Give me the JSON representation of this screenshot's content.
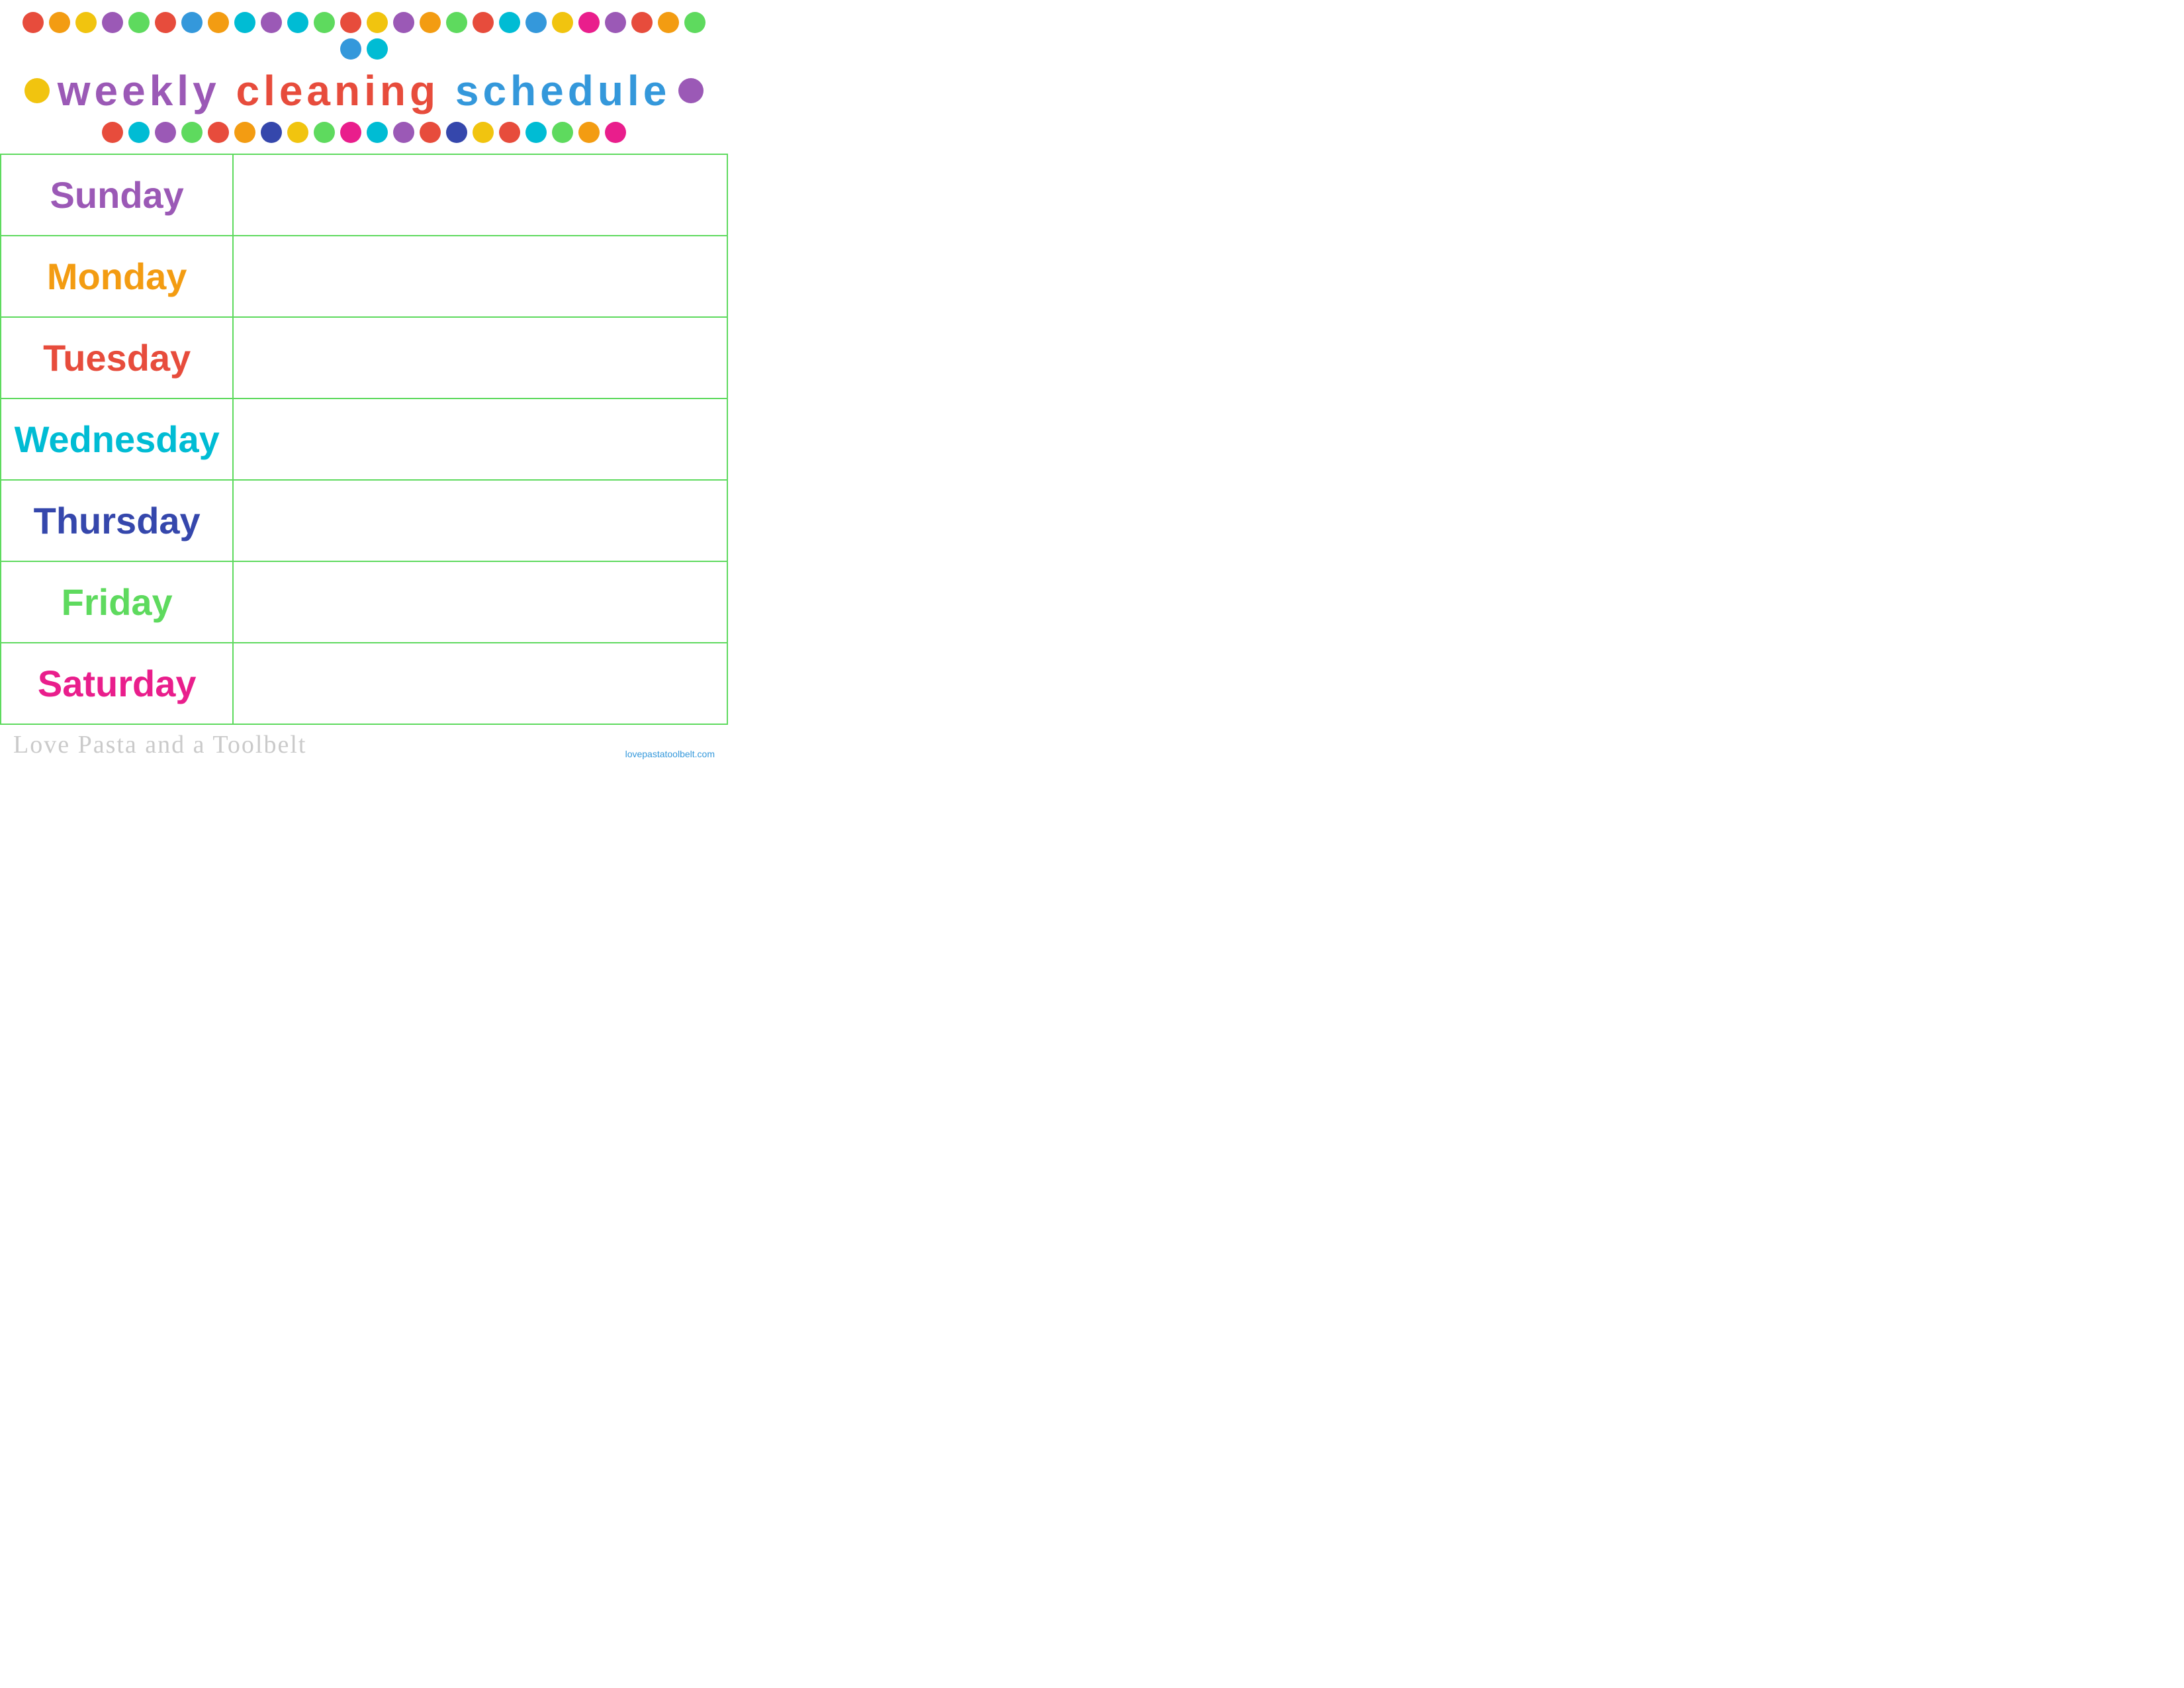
{
  "header": {
    "title": {
      "word1": "weekly",
      "word2": "cleaning",
      "word3": "schedule"
    }
  },
  "dots_top": [
    {
      "color": "#e74c3c"
    },
    {
      "color": "#f39c12"
    },
    {
      "color": "#f1c40f"
    },
    {
      "color": "#9b59b6"
    },
    {
      "color": "#5eda5e"
    },
    {
      "color": "#e74c3c"
    },
    {
      "color": "#3498db"
    },
    {
      "color": "#f39c12"
    },
    {
      "color": "#00bcd4"
    },
    {
      "color": "#9b59b6"
    },
    {
      "color": "#00bcd4"
    },
    {
      "color": "#5eda5e"
    },
    {
      "color": "#e74c3c"
    },
    {
      "color": "#f1c40f"
    },
    {
      "color": "#9b59b6"
    },
    {
      "color": "#f39c12"
    },
    {
      "color": "#5eda5e"
    },
    {
      "color": "#e74c3c"
    },
    {
      "color": "#00bcd4"
    },
    {
      "color": "#3498db"
    },
    {
      "color": "#f1c40f"
    },
    {
      "color": "#e91e8c"
    },
    {
      "color": "#9b59b6"
    },
    {
      "color": "#e74c3c"
    },
    {
      "color": "#f39c12"
    },
    {
      "color": "#5eda5e"
    },
    {
      "color": "#3498db"
    },
    {
      "color": "#00bcd4"
    }
  ],
  "dots_bottom": [
    {
      "color": "#e74c3c"
    },
    {
      "color": "#00bcd4"
    },
    {
      "color": "#9b59b6"
    },
    {
      "color": "#5eda5e"
    },
    {
      "color": "#e74c3c"
    },
    {
      "color": "#f39c12"
    },
    {
      "color": "#3547ac"
    },
    {
      "color": "#f1c40f"
    },
    {
      "color": "#5eda5e"
    },
    {
      "color": "#e91e8c"
    },
    {
      "color": "#00bcd4"
    },
    {
      "color": "#9b59b6"
    },
    {
      "color": "#e74c3c"
    },
    {
      "color": "#3547ac"
    },
    {
      "color": "#f1c40f"
    },
    {
      "color": "#e74c3c"
    },
    {
      "color": "#00bcd4"
    },
    {
      "color": "#5eda5e"
    },
    {
      "color": "#f39c12"
    },
    {
      "color": "#e91e8c"
    }
  ],
  "title_dot_left": {
    "color": "#f1c40f"
  },
  "title_dot_right": {
    "color": "#9b59b6"
  },
  "days": [
    {
      "label": "Sunday",
      "class": "sunday-label"
    },
    {
      "label": "Monday",
      "class": "monday-label"
    },
    {
      "label": "Tuesday",
      "class": "tuesday-label"
    },
    {
      "label": "Wednesday",
      "class": "wednesday-label"
    },
    {
      "label": "Thursday",
      "class": "thursday-label"
    },
    {
      "label": "Friday",
      "class": "friday-label"
    },
    {
      "label": "Saturday",
      "class": "saturday-label"
    }
  ],
  "footer": {
    "watermark": "Love Pasta and a Toolbelt",
    "url": "lovepastatoolbelt.com"
  }
}
